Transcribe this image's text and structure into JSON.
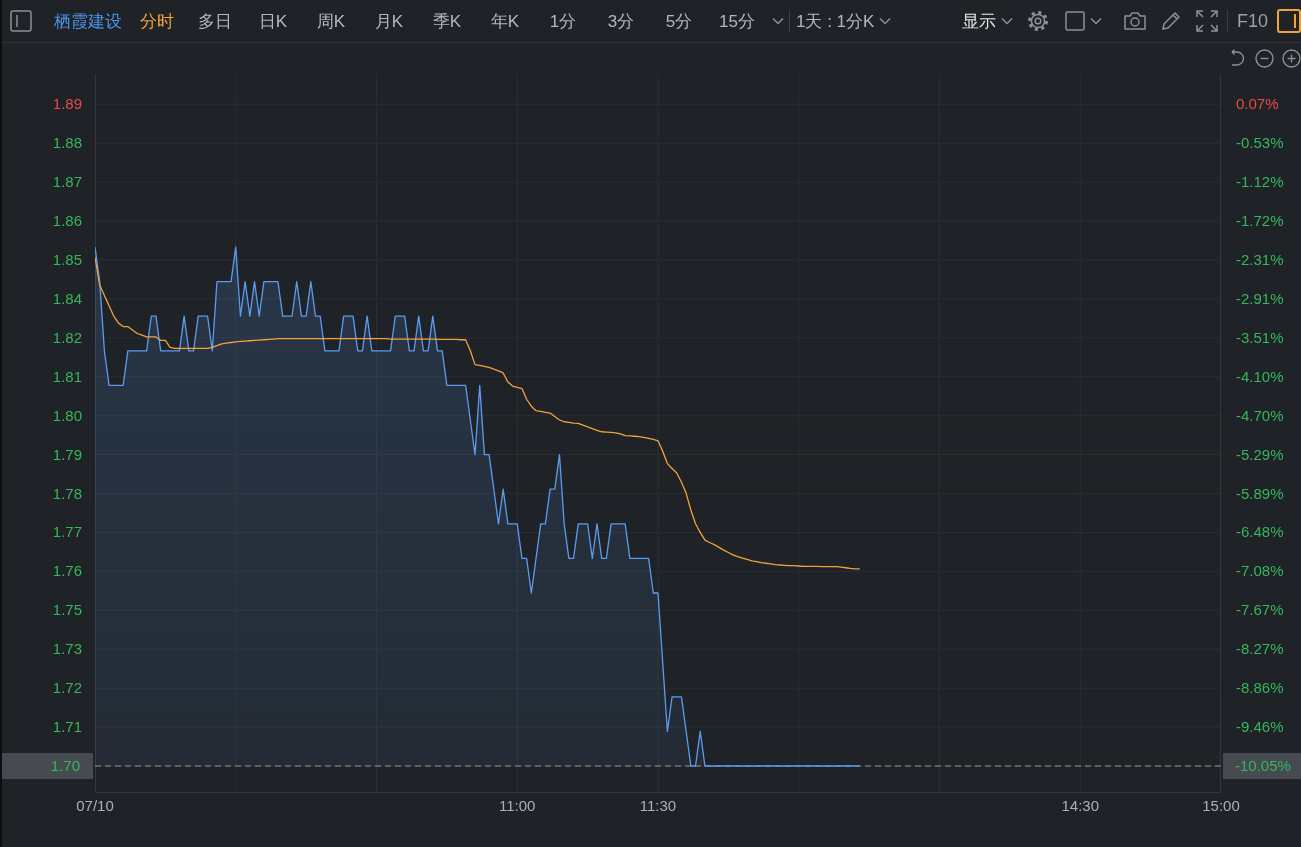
{
  "toolbar": {
    "left_panel_toggle": {
      "on": false
    },
    "stock_name": "栖霞建设",
    "periods": [
      {
        "label": "分时",
        "selected": true
      },
      {
        "label": "多日",
        "selected": false
      },
      {
        "label": "日K",
        "selected": false
      },
      {
        "label": "周K",
        "selected": false
      },
      {
        "label": "月K",
        "selected": false
      },
      {
        "label": "季K",
        "selected": false
      },
      {
        "label": "年K",
        "selected": false
      },
      {
        "label": "1分",
        "selected": false
      },
      {
        "label": "3分",
        "selected": false
      },
      {
        "label": "5分",
        "selected": false
      },
      {
        "label": "15分",
        "selected": false
      }
    ],
    "range_select": "1天 : 1分K",
    "display_menu": "显示",
    "f10_button": "F10",
    "right_panel_toggle": {
      "on": true
    }
  },
  "chart": {
    "chart_data": {
      "type": "line",
      "grid": true,
      "categories": [
        "07/10",
        null,
        null,
        null,
        null,
        null,
        null,
        null,
        null,
        null,
        null,
        null,
        null,
        null,
        null,
        null,
        null,
        null,
        null,
        null,
        null,
        null,
        null,
        null,
        null,
        null,
        null,
        null,
        null,
        null,
        null,
        null,
        null,
        null,
        null,
        null,
        null,
        null,
        null,
        null,
        null,
        null,
        null,
        null,
        null,
        null,
        null,
        null,
        null,
        null,
        null,
        null,
        null,
        null,
        null,
        null,
        null,
        null,
        null,
        null,
        null,
        null,
        null,
        null,
        null,
        null,
        null,
        null,
        null,
        null,
        null,
        null,
        null,
        null,
        null,
        null,
        null,
        null,
        null,
        null,
        null,
        null,
        null,
        null,
        null,
        null,
        null,
        null,
        null,
        null,
        "11:00",
        null,
        null,
        null,
        null,
        null,
        null,
        null,
        null,
        null,
        null,
        null,
        null,
        null,
        null,
        null,
        null,
        null,
        null,
        null,
        null,
        null,
        null,
        null,
        null,
        null,
        null,
        null,
        null,
        null,
        "11:30",
        null,
        null,
        null,
        null,
        null,
        null,
        null,
        null,
        null,
        null,
        null,
        null,
        null,
        null,
        null,
        null,
        null,
        null,
        null,
        null,
        null,
        null,
        null,
        null,
        null,
        null,
        null,
        null,
        null,
        null,
        null,
        null,
        null,
        null,
        null,
        null,
        null,
        null,
        null,
        null,
        null,
        null,
        null,
        null,
        null,
        null,
        null,
        null,
        null,
        null,
        null,
        null,
        null,
        null,
        null,
        null,
        null,
        null,
        null,
        null,
        null,
        null,
        null,
        null,
        null,
        null,
        null,
        null,
        null,
        null,
        null,
        null,
        null,
        null,
        null,
        null,
        null,
        null,
        null,
        null,
        null,
        null,
        null,
        null,
        null,
        null,
        null,
        null,
        null,
        "14:30",
        null,
        null,
        null,
        null,
        null,
        null,
        null,
        null,
        null,
        null,
        null,
        null,
        null,
        null,
        null,
        null,
        null,
        null,
        null,
        null,
        null,
        null,
        null,
        null,
        null,
        null,
        null,
        null,
        null,
        "15:00"
      ],
      "ylim": [
        1.6922,
        1.9
      ],
      "yticks": [
        {
          "value": 1.89125,
          "label": "1.89"
        },
        {
          "value": 1.88,
          "label": "1.88"
        },
        {
          "value": 1.86875,
          "label": "1.87"
        },
        {
          "value": 1.8575,
          "label": "1.86"
        },
        {
          "value": 1.84625,
          "label": "1.85"
        },
        {
          "value": 1.835,
          "label": "1.84"
        },
        {
          "value": 1.82375,
          "label": "1.82"
        },
        {
          "value": 1.8125,
          "label": "1.81"
        },
        {
          "value": 1.80125,
          "label": "1.80"
        },
        {
          "value": 1.79,
          "label": "1.79"
        },
        {
          "value": 1.77875,
          "label": "1.78"
        },
        {
          "value": 1.7675,
          "label": "1.77"
        },
        {
          "value": 1.75625,
          "label": "1.76"
        },
        {
          "value": 1.745,
          "label": "1.75"
        },
        {
          "value": 1.73375,
          "label": "1.73"
        },
        {
          "value": 1.7225,
          "label": "1.72"
        },
        {
          "value": 1.71125,
          "label": "1.71"
        },
        {
          "value": 1.7,
          "label": "1.70"
        }
      ],
      "series": [
        {
          "type": "area",
          "color": "#5b9bf0",
          "values": [
            1.85,
            1.84,
            1.82,
            1.81,
            1.81,
            1.81,
            1.81,
            1.82,
            1.82,
            1.82,
            1.82,
            1.82,
            1.83,
            1.83,
            1.82,
            1.82,
            1.82,
            1.82,
            1.82,
            1.83,
            1.82,
            1.82,
            1.83,
            1.83,
            1.83,
            1.82,
            1.84,
            1.84,
            1.84,
            1.84,
            1.85,
            1.83,
            1.84,
            1.83,
            1.84,
            1.83,
            1.84,
            1.84,
            1.84,
            1.84,
            1.83,
            1.83,
            1.83,
            1.84,
            1.83,
            1.83,
            1.84,
            1.83,
            1.83,
            1.82,
            1.82,
            1.82,
            1.82,
            1.83,
            1.83,
            1.83,
            1.82,
            1.82,
            1.83,
            1.82,
            1.82,
            1.82,
            1.82,
            1.82,
            1.83,
            1.83,
            1.83,
            1.82,
            1.82,
            1.83,
            1.82,
            1.82,
            1.83,
            1.82,
            1.82,
            1.81,
            1.81,
            1.81,
            1.81,
            1.81,
            1.8,
            1.79,
            1.81,
            1.79,
            1.79,
            1.78,
            1.77,
            1.78,
            1.77,
            1.77,
            1.77,
            1.76,
            1.76,
            1.75,
            1.76,
            1.77,
            1.77,
            1.78,
            1.78,
            1.79,
            1.77,
            1.76,
            1.76,
            1.77,
            1.77,
            1.77,
            1.76,
            1.77,
            1.76,
            1.76,
            1.77,
            1.77,
            1.77,
            1.77,
            1.76,
            1.76,
            1.76,
            1.76,
            1.76,
            1.75,
            1.75,
            1.73,
            1.71,
            1.72,
            1.72,
            1.72,
            1.71,
            1.7,
            1.7,
            1.71,
            1.7,
            1.7,
            1.7,
            1.7,
            1.7,
            1.7,
            1.7,
            1.7,
            1.7,
            1.7,
            1.7,
            1.7,
            1.7,
            1.7,
            1.7,
            1.7,
            1.7,
            1.7,
            1.7,
            1.7,
            1.7,
            1.7,
            1.7,
            1.7,
            1.7,
            1.7,
            1.7,
            1.7,
            1.7,
            1.7,
            1.7,
            1.7,
            1.7,
            1.7,
            null,
            null,
            null,
            null,
            null,
            null,
            null,
            null,
            null,
            null,
            null,
            null,
            null,
            null,
            null,
            null,
            null,
            null,
            null,
            null,
            null,
            null,
            null,
            null,
            null,
            null,
            null,
            null,
            null,
            null,
            null,
            null,
            null,
            null,
            null,
            null,
            null,
            null,
            null,
            null,
            null,
            null,
            null,
            null,
            null,
            null,
            null,
            null,
            null,
            null,
            null,
            null,
            null,
            null,
            null,
            null,
            null,
            null,
            null,
            null,
            null,
            null,
            null,
            null,
            null,
            null,
            null,
            null,
            null,
            null,
            null,
            null,
            null,
            null,
            null,
            null,
            null
          ]
        },
        {
          "type": "line",
          "color": "#f0a33a",
          "values": [
            1.847,
            1.839,
            1.836,
            1.833,
            1.83,
            1.828,
            1.827,
            1.827,
            1.826,
            1.825,
            1.8245,
            1.824,
            1.824,
            1.824,
            1.823,
            1.823,
            1.821,
            1.8207,
            1.8207,
            1.8207,
            1.8207,
            1.8207,
            1.8207,
            1.8207,
            1.8207,
            1.821,
            1.8215,
            1.822,
            1.8222,
            1.8224,
            1.8226,
            1.8227,
            1.8228,
            1.8229,
            1.823,
            1.8231,
            1.8232,
            1.8233,
            1.8234,
            1.8235,
            1.8235,
            1.8235,
            1.8235,
            1.8235,
            1.8235,
            1.8235,
            1.8235,
            1.8235,
            1.8235,
            1.8235,
            1.8235,
            1.8235,
            1.8235,
            1.8235,
            1.8235,
            1.8235,
            1.8235,
            1.8235,
            1.8235,
            1.8235,
            1.8235,
            1.8235,
            1.8235,
            1.8234,
            1.8234,
            1.8234,
            1.8234,
            1.8234,
            1.8234,
            1.8234,
            1.8234,
            1.8234,
            1.8234,
            1.8233,
            1.8233,
            1.8233,
            1.8233,
            1.8233,
            1.8232,
            1.8232,
            1.82,
            1.816,
            1.8158,
            1.8155,
            1.8152,
            1.8147,
            1.8142,
            1.8136,
            1.811,
            1.8098,
            1.8094,
            1.8091,
            1.806,
            1.804,
            1.8027,
            1.8025,
            1.8022,
            1.802,
            1.801,
            1.8,
            1.7995,
            1.7993,
            1.7991,
            1.799,
            1.7985,
            1.798,
            1.7975,
            1.797,
            1.7966,
            1.7965,
            1.7964,
            1.7963,
            1.796,
            1.7955,
            1.7954,
            1.7953,
            1.7952,
            1.795,
            1.7947,
            1.7944,
            1.794,
            1.791,
            1.7874,
            1.786,
            1.7847,
            1.782,
            1.7788,
            1.774,
            1.77,
            1.7675,
            1.7653,
            1.7646,
            1.764,
            1.7632,
            1.7624,
            1.7617,
            1.761,
            1.7605,
            1.7601,
            1.7597,
            1.7593,
            1.7591,
            1.7588,
            1.7586,
            1.7584,
            1.7582,
            1.7581,
            1.758,
            1.7579,
            1.7579,
            1.7578,
            1.7577,
            1.7577,
            1.7577,
            1.7577,
            1.7576,
            1.7576,
            1.7576,
            1.7576,
            1.7575,
            1.7573,
            1.7571,
            1.757,
            1.757,
            null,
            null,
            null,
            null,
            null,
            null,
            null,
            null,
            null,
            null,
            null,
            null,
            null,
            null,
            null,
            null,
            null,
            null,
            null,
            null,
            null,
            null,
            null,
            null,
            null,
            null,
            null,
            null,
            null,
            null,
            null,
            null,
            null,
            null,
            null,
            null,
            null,
            null,
            null,
            null,
            null,
            null,
            null,
            null,
            null,
            null,
            null,
            null,
            null,
            null,
            null,
            null,
            null,
            null,
            null,
            null,
            null,
            null,
            null,
            null,
            null,
            null,
            null,
            null,
            null,
            null,
            null,
            null,
            null,
            null,
            null,
            null,
            null,
            null,
            null,
            null,
            null
          ]
        }
      ],
      "ref_lines": [
        {
          "axis": "y",
          "value": 1.7
        }
      ]
    },
    "percent_axis": [
      {
        "label": "0.07%",
        "color": "#ea4b45",
        "highlighted": false
      },
      {
        "label": "-0.53%",
        "color": "#36b65c",
        "highlighted": false
      },
      {
        "label": "-1.12%",
        "color": "#36b65c",
        "highlighted": false
      },
      {
        "label": "-1.72%",
        "color": "#36b65c",
        "highlighted": false
      },
      {
        "label": "-2.31%",
        "color": "#36b65c",
        "highlighted": false
      },
      {
        "label": "-2.91%",
        "color": "#36b65c",
        "highlighted": false
      },
      {
        "label": "-3.51%",
        "color": "#36b65c",
        "highlighted": false
      },
      {
        "label": "-4.10%",
        "color": "#36b65c",
        "highlighted": false
      },
      {
        "label": "-4.70%",
        "color": "#36b65c",
        "highlighted": false
      },
      {
        "label": "-5.29%",
        "color": "#36b65c",
        "highlighted": false
      },
      {
        "label": "-5.89%",
        "color": "#36b65c",
        "highlighted": false
      },
      {
        "label": "-6.48%",
        "color": "#36b65c",
        "highlighted": false
      },
      {
        "label": "-7.08%",
        "color": "#36b65c",
        "highlighted": false
      },
      {
        "label": "-7.67%",
        "color": "#36b65c",
        "highlighted": false
      },
      {
        "label": "-8.27%",
        "color": "#36b65c",
        "highlighted": false
      },
      {
        "label": "-8.86%",
        "color": "#36b65c",
        "highlighted": false
      },
      {
        "label": "-9.46%",
        "color": "#36b65c",
        "highlighted": false
      },
      {
        "label": "-10.05%",
        "color": "#36b65c",
        "highlighted": true
      }
    ]
  }
}
